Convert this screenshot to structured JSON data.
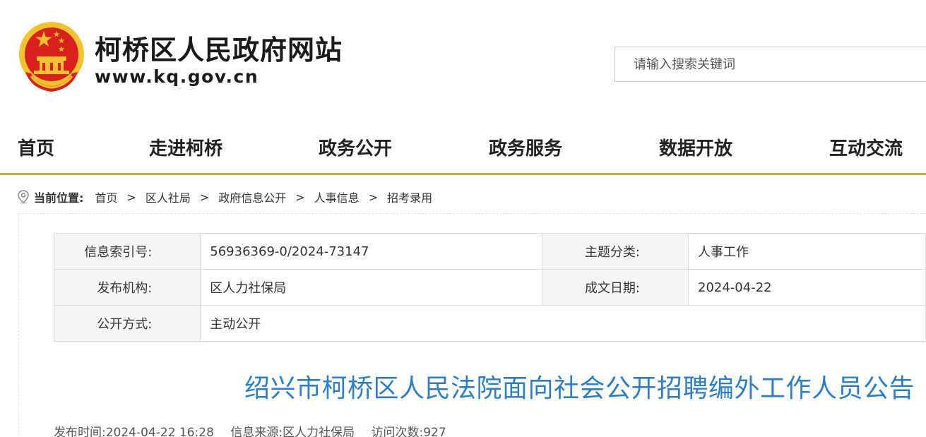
{
  "header": {
    "site_title": "柯桥区人民政府网站",
    "site_domain": "www.kq.gov.cn",
    "search_placeholder": "请输入搜索关键词"
  },
  "nav": {
    "items": [
      "首页",
      "走进柯桥",
      "政务公开",
      "政务服务",
      "数据开放",
      "互动交流"
    ]
  },
  "breadcrumb": {
    "label": "当前位置:",
    "items": [
      "首页",
      "区人社局",
      "政府信息公开",
      "人事信息",
      "招考录用"
    ],
    "separator": ">"
  },
  "meta": {
    "index_label": "信息索引号:",
    "index_value": "56936369-0/2024-73147",
    "topic_label": "主题分类:",
    "topic_value": "人事工作",
    "org_label": "发布机构:",
    "org_value": "区人力社保局",
    "date_label": "成文日期:",
    "date_value": "2024-04-22",
    "mode_label": "公开方式:",
    "mode_value": "主动公开"
  },
  "article": {
    "title": "绍兴市柯桥区人民法院面向社会公开招聘编外工作人员公告",
    "publish_time": "发布时间:2024-04-22 16:28",
    "source": "信息来源:区人力社保局",
    "visits": "访问次数:927"
  },
  "colors": {
    "nav_underline": "#d4a84c",
    "title_blue": "#2f7ec4",
    "emblem_red": "#d8201c",
    "emblem_gold": "#f2c230"
  }
}
